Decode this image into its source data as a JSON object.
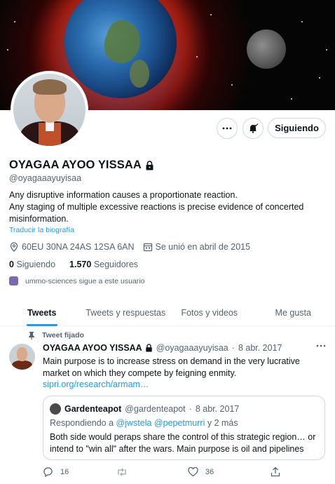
{
  "profile": {
    "name": "OYAGAA AYOO YISSAA",
    "handle": "@oyagaaayuyisaa",
    "bio_line1": "Any disruptive information causes a proportionate reaction.",
    "bio_line2": "Any staging of multiple excessive reactions is precise evidence of concerted misinformation.",
    "translate": "Traducir la biografía",
    "location": "60EU 30NA 24AS 12SA 6AN",
    "joined": "Se unió en abril de 2015",
    "following_count": "0",
    "following_label": "Siguiendo",
    "followers_count": "1.570",
    "followers_label": "Seguidores",
    "followed_by": "ummo-sciences sigue a este usuario",
    "follow_button": "Siguiendo"
  },
  "tabs": [
    "Tweets",
    "Tweets y respuestas",
    "Fotos y videos",
    "Me gusta"
  ],
  "tweet": {
    "pinned_label": "Tweet fijado",
    "name": "OYAGAA AYOO YISSAA",
    "handle": "@oyagaaayuyisaa",
    "dot": "·",
    "date": "8 abr. 2017",
    "text": "Main purpose is to increase stress on demand in the very lucrative market on which they compete by feigning enmity.",
    "link": "sipri.org/research/armam…",
    "quote": {
      "name": "Gardenteapot",
      "handle": "@gardenteapot",
      "date": "8 abr. 2017",
      "reply_prefix": "Respondiendo a",
      "reply_user1": "@jwstela",
      "reply_user2": "@pepetmurri",
      "reply_suffix": "y 2 más",
      "text": "Both side would peraps share the control of this strategic region… or intend to \"win all\" after the wars. Main purpose is oil and pipelines"
    },
    "reply_count": "16",
    "like_count": "36"
  },
  "colors": {
    "accent": "#1d9bf0",
    "muted": "#536471",
    "text": "#0f1419"
  }
}
